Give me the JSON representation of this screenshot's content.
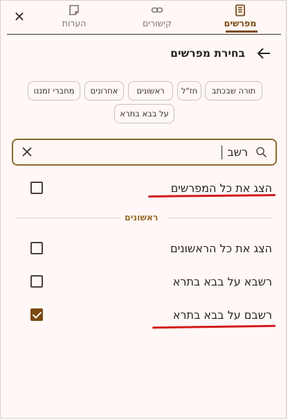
{
  "tabs": [
    {
      "label": "הערות",
      "icon": "note-icon"
    },
    {
      "label": "קישורים",
      "icon": "link-icon"
    },
    {
      "label": "מפרשים",
      "icon": "book-icon",
      "active": true
    }
  ],
  "header": {
    "title": "בחירת מפרשים"
  },
  "filters": [
    "תורה שבכתב",
    "חז\"ל",
    "ראשונים",
    "אחרונים",
    "מחברי זמננו",
    "על בבא בתרא"
  ],
  "search": {
    "value": "רשב"
  },
  "rows": {
    "show_all_commentators": {
      "label": "הצג את כל המפרשים",
      "checked": false
    },
    "section_title": "ראשונים",
    "show_all_rishonim": {
      "label": "הצג את כל הראשונים",
      "checked": false
    },
    "rashba": {
      "label": "רשבא על בבא בתרא",
      "checked": false
    },
    "rashbam": {
      "label": "רשבם על בבא בתרא",
      "checked": true
    }
  },
  "colors": {
    "accent": "#7a4b13",
    "annotation": "#d41a1a",
    "background": "#fff8f6"
  }
}
